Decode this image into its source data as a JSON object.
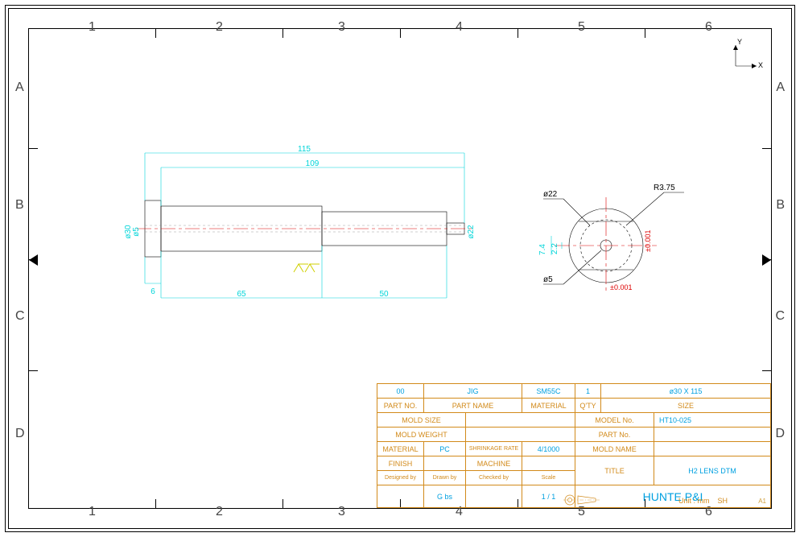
{
  "zones": {
    "cols": [
      "1",
      "2",
      "3",
      "4",
      "5",
      "6"
    ],
    "rows": [
      "A",
      "B",
      "C",
      "D"
    ]
  },
  "dims": {
    "l115": "115",
    "l109": "109",
    "d30": "ø30",
    "d5c": "ø5",
    "d22ax": "ø22",
    "l65": "65",
    "l50": "50",
    "l6": "6",
    "d22top": "ø22",
    "r375": "R3.75",
    "w74": "7.4",
    "w22": "2.2",
    "tol1": "±0.001",
    "tol2": "±0.001",
    "d5bot": "ø5"
  },
  "surf": "",
  "coord": {
    "x": "X",
    "y": "Y"
  },
  "title_block": {
    "row1": {
      "no": "00",
      "name": "JIG",
      "mat": "SM55C",
      "qty": "1",
      "size": "ø30 X 115"
    },
    "hdr1": {
      "no": "PART NO.",
      "name": "PART NAME",
      "mat": "MATERIAL",
      "qty": "Q'TY",
      "size": "SIZE"
    },
    "mold_size": "MOLD SIZE",
    "model_no": "MODEL No.",
    "model_val": "HT10-025",
    "mold_weight": "MOLD WEIGHT",
    "part_no": "PART No.",
    "part_val": "",
    "material": "MATERIAL",
    "material_v": "PC",
    "shrink": "SHRINKAGE RATE",
    "shrink_v": "4/1000",
    "moldname": "MOLD NAME",
    "moldname_v": "",
    "finish": "FINISH",
    "machine": "MACHINE",
    "title": "TITLE",
    "title_v": "H2 LENS DTM",
    "designed": "Designed by",
    "drawn": "Drawn by",
    "checked": "Checked by",
    "scale": "Scale",
    "drawn_v": "G bs",
    "scale_v": "1 / 1",
    "company": "HUNTE P&I"
  },
  "footer": {
    "unit": "Unit : mm",
    "sh": "SH"
  },
  "a1": "A1"
}
